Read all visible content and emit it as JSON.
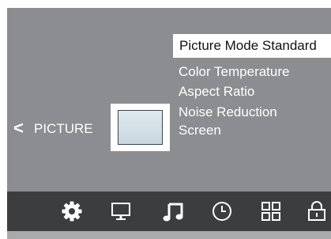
{
  "menu": {
    "section": "PICTURE",
    "back_symbol": "<",
    "selected_item": "Picture Mode Standard",
    "items": [
      "Color Temperature",
      "Aspect Ratio",
      "Noise Reduction",
      "Screen"
    ]
  },
  "icon_bar": {
    "icons": [
      "gear-icon",
      "monitor-icon",
      "music-note-icon",
      "clock-icon",
      "grid-icon",
      "lock-icon"
    ],
    "selected": "gear-icon"
  },
  "colors": {
    "panel": "#8c8d90",
    "icon_bar": "#3b3d3e",
    "highlight": "#ffffff",
    "text": "#ffffff"
  }
}
